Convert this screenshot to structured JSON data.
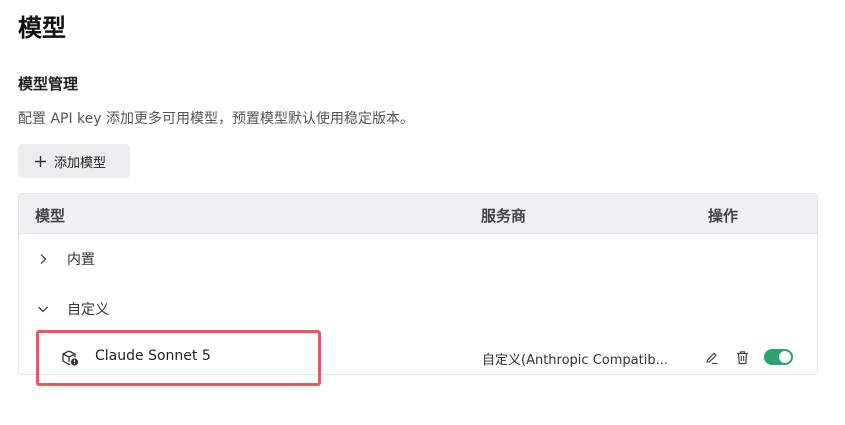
{
  "page": {
    "title": "模型"
  },
  "section": {
    "title": "模型管理",
    "description": "配置 API key 添加更多可用模型，预置模型默认使用稳定版本。"
  },
  "add_button": {
    "label": "添加模型",
    "icon": "plus-icon"
  },
  "table": {
    "headers": {
      "model": "模型",
      "provider": "服务商",
      "actions": "操作"
    },
    "groups": [
      {
        "label": "内置",
        "expanded": false,
        "icon": "chevron-right-icon"
      },
      {
        "label": "自定义",
        "expanded": true,
        "icon": "chevron-down-icon"
      }
    ],
    "rows": [
      {
        "name": "Claude Sonnet 5",
        "provider": "自定义(Anthropic Compatib...",
        "enabled": true,
        "icon": "custom-model-icon"
      }
    ]
  },
  "colors": {
    "toggle_on": "#2ba471",
    "highlight": "#f0545c",
    "header_bg": "#eef0f3",
    "button_bg": "#ebedf0"
  }
}
